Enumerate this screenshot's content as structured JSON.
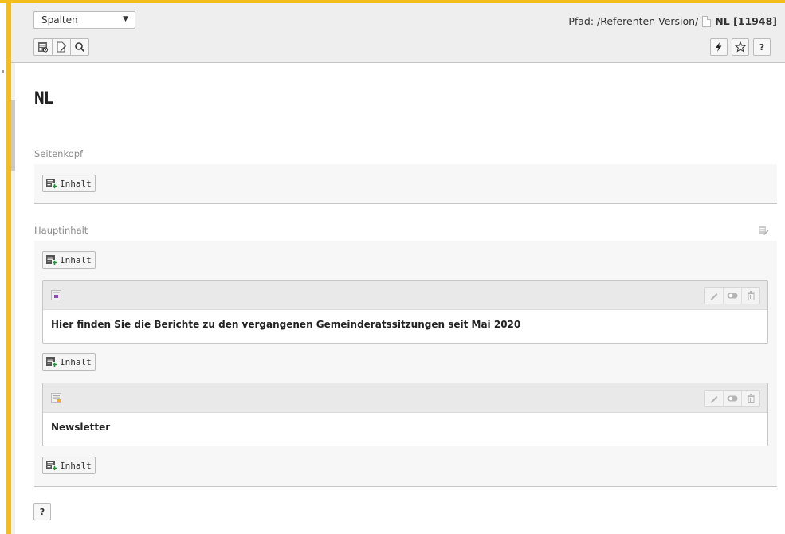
{
  "docheader": {
    "view_select": {
      "selected": "Spalten"
    },
    "path": {
      "label": "Pfad: /Referenten Version/",
      "page_name": "NL [11948]"
    },
    "icons_left": [
      "view-webpage-icon",
      "edit-page-icon",
      "search-icon"
    ],
    "icons_right": [
      "flash-clear-cache-icon",
      "bookmark-star-icon",
      "help-icon"
    ],
    "help_label": "?"
  },
  "page": {
    "title": "NL"
  },
  "columns": [
    {
      "name": "Seitenkopf",
      "add_label": "Inhalt",
      "elements": []
    },
    {
      "name": "Hauptinhalt",
      "add_label": "Inhalt",
      "elements": [
        {
          "type_icon": "plugin-icon",
          "text": "Hier finden Sie die Berichte zu den vergangenen Gemeinderatssitzungen seit Mai 2020",
          "add_label": "Inhalt"
        },
        {
          "type_icon": "text-icon",
          "text": "Newsletter",
          "add_label": "Inhalt"
        }
      ]
    }
  ],
  "footer": {
    "help_label": "?"
  },
  "colors": {
    "frame_accent": "#f3bd1b",
    "header_bg": "#eeeeee"
  }
}
